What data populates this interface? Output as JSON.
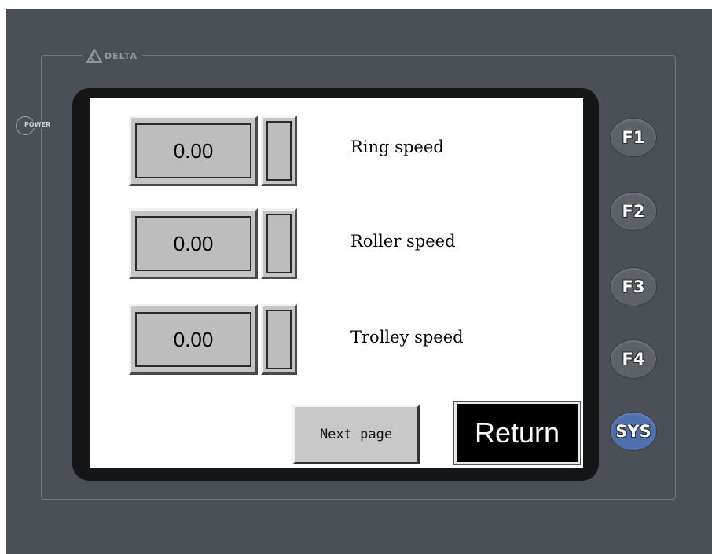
{
  "panel": {
    "brand": "DELTA",
    "power_label": "POWER"
  },
  "fields": [
    {
      "value": "0.00",
      "label": "Ring speed"
    },
    {
      "value": "0.00",
      "label": "Roller speed"
    },
    {
      "value": "0.00",
      "label": "Trolley speed"
    }
  ],
  "buttons": {
    "next_page": "Next page",
    "return": "Return"
  },
  "function_keys": [
    "F1",
    "F2",
    "F3",
    "F4",
    "SYS"
  ],
  "colors": {
    "case": "#4a5056",
    "screen": "#ffffff",
    "field": "#c4c4c4",
    "sys_key": "#4f6fae"
  }
}
